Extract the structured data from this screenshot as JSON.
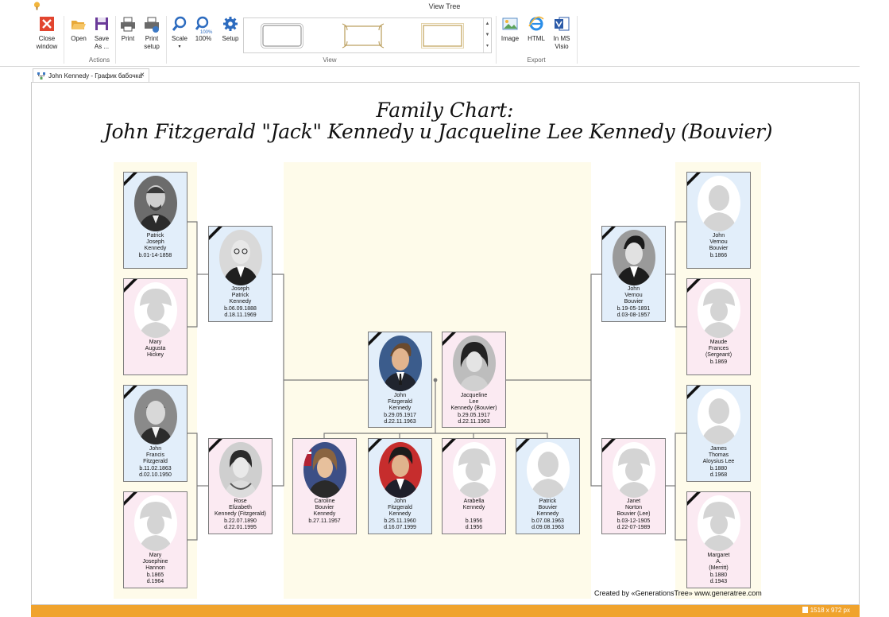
{
  "window": {
    "title": "View Tree"
  },
  "ribbon": {
    "buttons": {
      "close": "Close\nwindow",
      "open": "Open",
      "save": "Save\nAs ...",
      "print": "Print",
      "print_setup": "Print\nsetup",
      "scale": "Scale",
      "zoom100": "100%",
      "setup": "Setup",
      "image": "Image",
      "html": "HTML",
      "visio": "In MS\nVisio"
    },
    "groups": {
      "actions": "Actions",
      "view": "View",
      "export": "Export"
    },
    "zoom_badge": "100%"
  },
  "tab": {
    "label": "John Kennedy - График бабочка"
  },
  "chart": {
    "title": "Family Chart:",
    "subtitle": "John Fitzgerald \"Jack\" Kennedy и Jacqueline Lee Kennedy (Bouvier)",
    "credits": "Created by «GenerationsTree» www.generatree.com"
  },
  "people": {
    "patrick_sr": {
      "text": "Patrick\nJoseph\nKennedy\nb.01-14-1858"
    },
    "mary_hickey": {
      "text": "Mary\nAugusta\nHickey"
    },
    "john_fitzgerald_sr": {
      "text": "John\nFrancis\nFitzgerald\nb.11.02.1863\nd.02.10.1950"
    },
    "mary_hannon": {
      "text": "Mary\nJosephine\nHannon\nb.1865\nd.1964"
    },
    "joseph_kennedy": {
      "text": "Joseph\nPatrick\nKennedy\nb.06.09.1888\nd.18.11.1969"
    },
    "rose_kennedy": {
      "text": "Rose\nElizabeth\nKennedy (Fitzgerald)\nb.22.07.1890\nd.22.01.1995"
    },
    "jfk": {
      "text": "John\nFitzgerald\nKennedy\nb.29.05.1917\nd.22.11.1963"
    },
    "jackie": {
      "text": "Jacqueline\nLee\nKennedy (Bouvier)\nb.29.05.1917\nd.22.11.1963"
    },
    "caroline": {
      "text": "Caroline\nBouvier\nKennedy\nb.27.11.1957"
    },
    "jfk_jr": {
      "text": "John\nFitzgerald\nKennedy\nb.25.11.1960\nd.16.07.1999"
    },
    "arabella": {
      "text": "Arabella\nKennedy\n\nb.1956\nd.1956"
    },
    "patrick_bouvier": {
      "text": "Patrick\nBouvier\nKennedy\nb.07.08.1963\nd.09.08.1963"
    },
    "john_v_bouvier_sr": {
      "text": "John\nVernou\nBouvier\nb.1866"
    },
    "maude_frances": {
      "text": "Maude\nFrances\n(Sergeant)\nb.1869"
    },
    "james_lee": {
      "text": "James\nThomas\nAloysius Lee\nb.1880\nd.1968"
    },
    "margaret_merritt": {
      "text": "Margaret\nA.\n(Merritt)\nb.1880\nd.1943"
    },
    "john_v_bouvier": {
      "text": "John\nVernou\nBouvier\nb.19-05-1891\nd.03-08-1957"
    },
    "janet_lee": {
      "text": "Janet\nNorton\nBouvier (Lee)\nb.03-12-1905\nd.22-07-1989"
    }
  },
  "status": {
    "size": "1518 x 972 px"
  },
  "colors": {
    "male_card": "#e2eefa",
    "female_card": "#fbeaf2",
    "panel": "#fefbea",
    "statusbar": "#f0a32d"
  }
}
